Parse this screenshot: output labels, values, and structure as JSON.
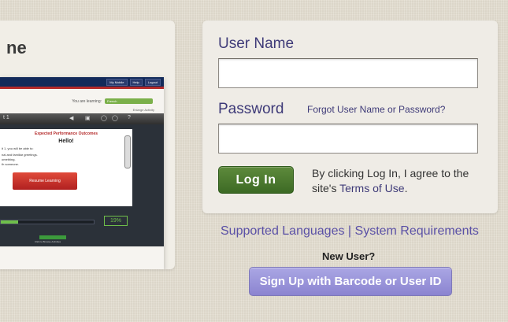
{
  "promo": {
    "heading": "ne",
    "screenshot": {
      "nav": [
        "My Mobile",
        "Help",
        "Logout"
      ],
      "learning_label": "You are learning:",
      "learning_value": "French",
      "enlarge": "Enlarge Activity",
      "activity_left": "t 1",
      "activity_icons": [
        "◀",
        "▣",
        "◯",
        "◯",
        "?"
      ],
      "outcome_title": "Expected Performance Outcomes",
      "outcome_hello": "Hello!",
      "outcome_lines": [
        "it 1, you will be able to:",
        "nal and familiar greetings.",
        "omething.",
        "th someone."
      ],
      "resume": "Resume Learning",
      "progress": 0.19,
      "progress_label": "19%",
      "browse": "Click to Browse Activities"
    }
  },
  "login": {
    "username_label": "User Name",
    "username_value": "",
    "password_label": "Password",
    "password_value": "",
    "forgot": "Forgot User Name or Password?",
    "login_button": "Log In",
    "agree_prefix": "By clicking Log In, I agree to the site's ",
    "terms": "Terms of Use",
    "agree_suffix": "."
  },
  "links": {
    "supported_languages": "Supported Languages",
    "separator": " | ",
    "system_requirements": "System Requirements"
  },
  "signup": {
    "new_user": "New User?",
    "button": "Sign Up with Barcode or User ID"
  }
}
